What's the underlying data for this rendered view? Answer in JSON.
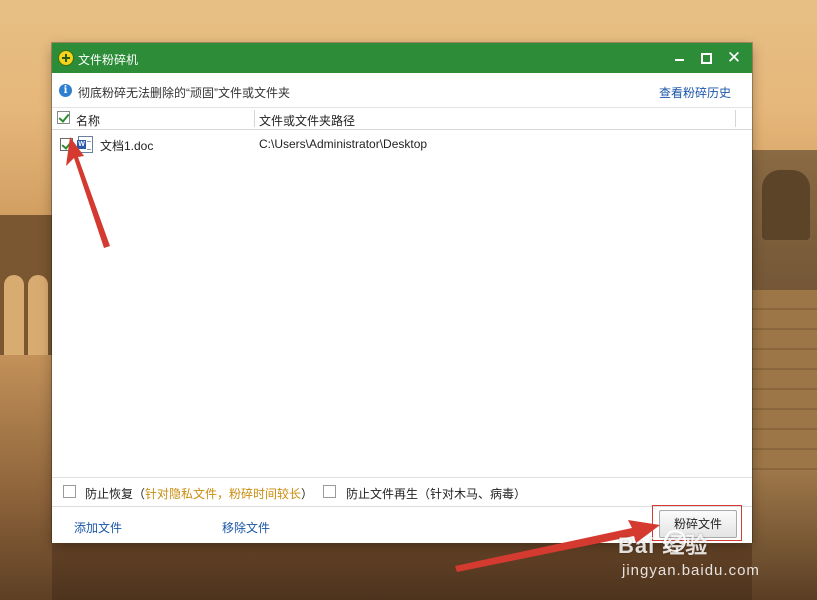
{
  "window": {
    "title": "文件粉碎机"
  },
  "infobar": {
    "text": "彻底粉碎无法删除的“顽固”文件或文件夹",
    "history_link": "查看粉碎历史"
  },
  "table": {
    "columns": {
      "name": "名称",
      "path": "文件或文件夹路径"
    },
    "rows": [
      {
        "name": "文档1.doc",
        "path": "C:\\Users\\Administrator\\Desktop",
        "checked": true
      }
    ]
  },
  "options": {
    "prevent_recovery": "防止恢复（",
    "prevent_recovery_note": "针对隐私文件，粉碎时间较长",
    "prevent_recovery_close": "）",
    "prevent_regen": "防止文件再生（针对木马、病毒）"
  },
  "footer": {
    "add_file": "添加文件",
    "remove_file": "移除文件",
    "shred_button": "粉碎文件"
  },
  "watermark": {
    "logo": "Bai  经验",
    "url": "jingyan.baidu.com"
  },
  "colors": {
    "titlebar": "#2c8c38",
    "link": "#1a56a8",
    "note": "#c98d0f",
    "annotation": "#d43a2f"
  }
}
